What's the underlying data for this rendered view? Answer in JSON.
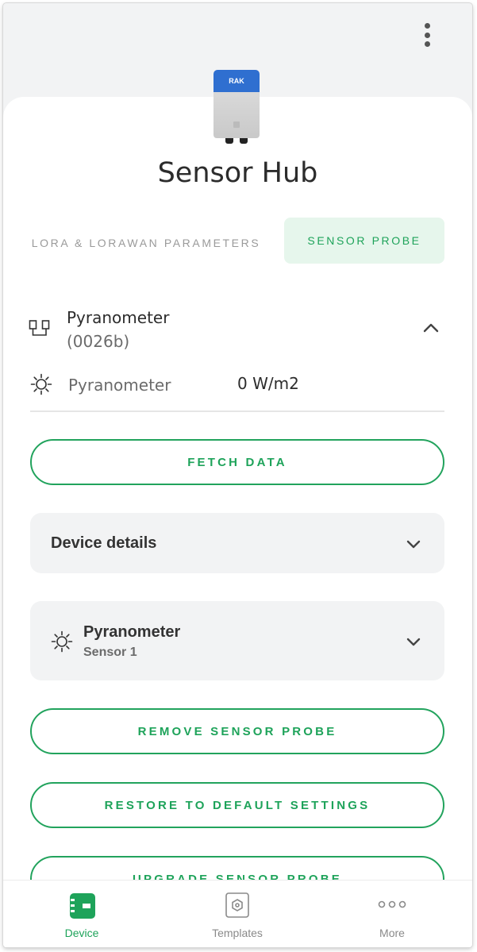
{
  "device": {
    "title": "Sensor Hub",
    "logo_text": "RAK"
  },
  "tabs": [
    {
      "label": "LORA & LORAWAN PARAMETERS",
      "active": false
    },
    {
      "label": "SENSOR PROBE",
      "active": true
    }
  ],
  "probe": {
    "name": "Pyranometer",
    "id": "(0026b)",
    "reading": {
      "label": "Pyranometer",
      "value": "0 W/m2"
    }
  },
  "buttons": {
    "fetch": "FETCH DATA",
    "remove": "REMOVE SENSOR PROBE",
    "restore": "RESTORE TO DEFAULT SETTINGS",
    "upgrade": "UPGRADE SENSOR PROBE"
  },
  "accordions": {
    "device_details": "Device details",
    "sensor_title": "Pyranometer",
    "sensor_subtitle": "Sensor 1"
  },
  "nav": [
    {
      "label": "Device",
      "icon": "device-icon",
      "active": true
    },
    {
      "label": "Templates",
      "icon": "templates-icon",
      "active": false
    },
    {
      "label": "More",
      "icon": "more-dots-icon",
      "active": false
    }
  ],
  "colors": {
    "accent": "#1ea35a",
    "accent_bg": "#e6f6ec",
    "brand_blue": "#2f6fd0"
  }
}
